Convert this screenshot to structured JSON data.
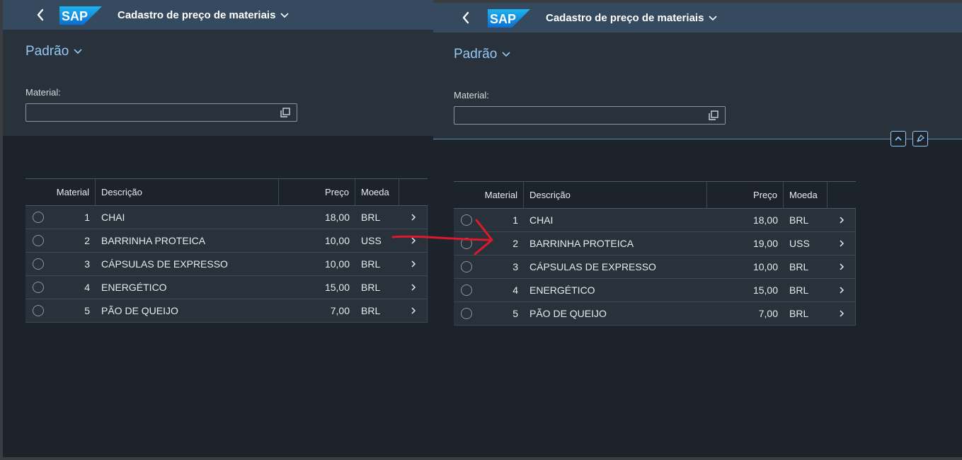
{
  "shell": {
    "logo": "SAP",
    "app_title": "Cadastro de preço de materiais"
  },
  "filter": {
    "variant": "Padrão",
    "material_label": "Material:",
    "material_value": ""
  },
  "columns": {
    "material": "Material",
    "descricao": "Descrição",
    "preco": "Preço",
    "moeda": "Moeda"
  },
  "before": {
    "rows": [
      {
        "material": "1",
        "descricao": "CHAI",
        "preco": "18,00",
        "moeda": "BRL"
      },
      {
        "material": "2",
        "descricao": "BARRINHA PROTEICA",
        "preco": "10,00",
        "moeda": "USS"
      },
      {
        "material": "3",
        "descricao": "CÁPSULAS DE EXPRESSO",
        "preco": "10,00",
        "moeda": "BRL"
      },
      {
        "material": "4",
        "descricao": "ENERGÉTICO",
        "preco": "15,00",
        "moeda": "BRL"
      },
      {
        "material": "5",
        "descricao": "PÃO DE QUEIJO",
        "preco": "7,00",
        "moeda": "BRL"
      }
    ]
  },
  "after": {
    "rows": [
      {
        "material": "1",
        "descricao": "CHAI",
        "preco": "18,00",
        "moeda": "BRL"
      },
      {
        "material": "2",
        "descricao": "BARRINHA PROTEICA",
        "preco": "19,00",
        "moeda": "USS"
      },
      {
        "material": "3",
        "descricao": "CÁPSULAS DE EXPRESSO",
        "preco": "10,00",
        "moeda": "BRL"
      },
      {
        "material": "4",
        "descricao": "ENERGÉTICO",
        "preco": "15,00",
        "moeda": "BRL"
      },
      {
        "material": "5",
        "descricao": "PÃO DE QUEIJO",
        "preco": "7,00",
        "moeda": "BRL"
      }
    ]
  },
  "icons": {
    "back": "back-arrow-icon",
    "title_menu": "chevron-down-icon",
    "value_help": "value-help-icon",
    "collapse": "chevron-up-icon",
    "pin": "pin-icon",
    "row_nav": "chevron-right-icon",
    "annotation": "red-arrow-annotation"
  },
  "colors": {
    "shell": "#354a5f",
    "header": "#29313a",
    "background": "#1d232b",
    "link": "#91c8f6",
    "annotation": "#e0182d"
  }
}
